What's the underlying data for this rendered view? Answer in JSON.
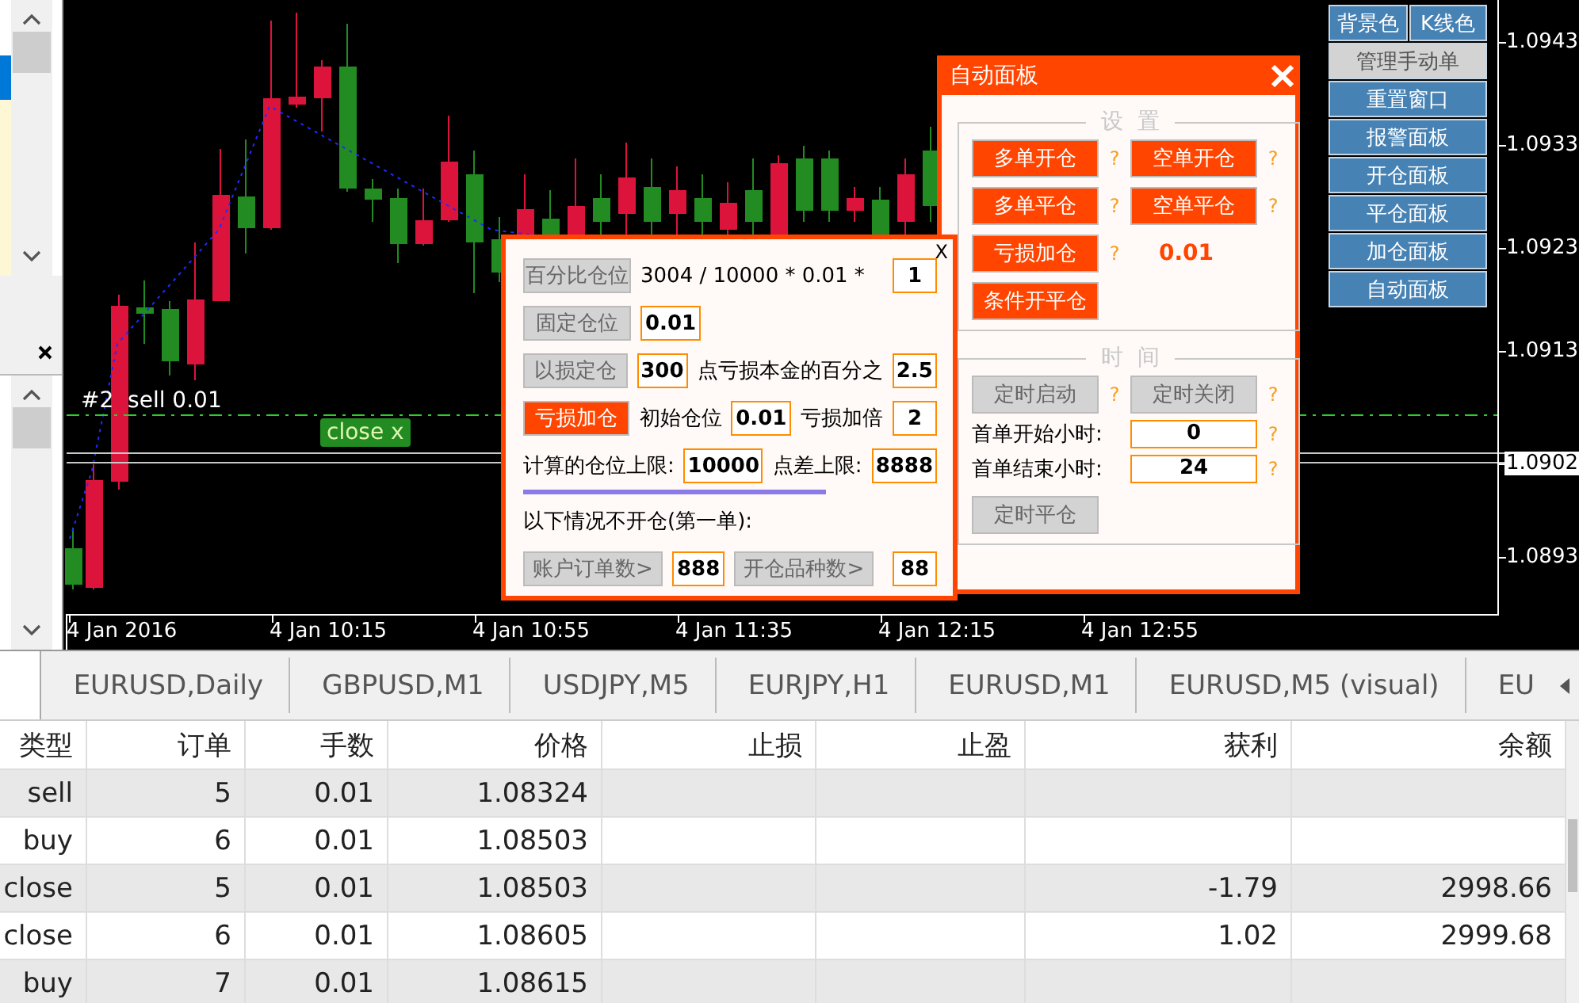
{
  "chart": {
    "order_label": "#2  sell 0.01",
    "close_badge": "close x",
    "price_labels": [
      {
        "label": "1.0943",
        "kind": "tick"
      },
      {
        "label": "1.0933",
        "kind": "tick"
      },
      {
        "label": "1.0923",
        "kind": "tick"
      },
      {
        "label": "1.0913",
        "kind": "tick"
      },
      {
        "label": "1.0902",
        "kind": "current"
      },
      {
        "label": "1.0893",
        "kind": "tick"
      }
    ],
    "time_labels": [
      "4 Jan 2016",
      "4 Jan 10:15",
      "4 Jan 10:55",
      "4 Jan 11:35",
      "4 Jan 12:15",
      "4 Jan 12:55"
    ]
  },
  "side_buttons": [
    {
      "buttons": [
        {
          "label": "背景色",
          "disabled": false
        },
        {
          "label": "K线色",
          "disabled": false
        }
      ]
    },
    {
      "buttons": [
        {
          "label": "管理手动单",
          "disabled": true
        }
      ]
    },
    {
      "buttons": [
        {
          "label": "重置窗口",
          "disabled": false
        }
      ]
    },
    {
      "buttons": [
        {
          "label": "报警面板",
          "disabled": false
        }
      ]
    },
    {
      "buttons": [
        {
          "label": "开仓面板",
          "disabled": false
        }
      ]
    },
    {
      "buttons": [
        {
          "label": "平仓面板",
          "disabled": false
        }
      ]
    },
    {
      "buttons": [
        {
          "label": "加仓面板",
          "disabled": false
        }
      ]
    },
    {
      "buttons": [
        {
          "label": "自动面板",
          "disabled": false
        }
      ]
    }
  ],
  "auto_panel": {
    "title": "自动面板",
    "settings_legend": "设  置",
    "settings": [
      {
        "kind": "button",
        "label": "多单开仓",
        "help": "?",
        "disabled": false
      },
      {
        "kind": "button",
        "label": "空单开仓",
        "help": "?",
        "disabled": false
      },
      {
        "kind": "button",
        "label": "多单平仓",
        "help": "?",
        "disabled": false
      },
      {
        "kind": "button",
        "label": "空单平仓",
        "help": "?",
        "disabled": false
      },
      {
        "kind": "button",
        "label": "亏损加仓",
        "help": "?",
        "disabled": false
      },
      {
        "kind": "value",
        "text": "0.01"
      },
      {
        "kind": "button",
        "label": "条件开平仓",
        "disabled": false
      }
    ],
    "time_legend": "时  间",
    "time_buttons": [
      {
        "label": "定时启动",
        "help": "?",
        "disabled": true
      },
      {
        "label": "定时关闭",
        "help": "?",
        "disabled": true
      }
    ],
    "hours": [
      {
        "label": "首单开始小时:",
        "value": "0",
        "help": "?"
      },
      {
        "label": "首单结束小时:",
        "value": "24",
        "help": "?"
      }
    ],
    "timed_close": {
      "label": "定时平仓",
      "disabled": true
    }
  },
  "calc_panel": {
    "close_label": "X",
    "mode_buttons": [
      {
        "label": "百分比仓位",
        "selected": false
      },
      {
        "label": "固定仓位",
        "selected": false
      },
      {
        "label": "以损定仓",
        "selected": false
      },
      {
        "label": "亏损加仓",
        "selected": true
      }
    ],
    "percent_formula": "3004 / 10000 * 0.01 *",
    "percent_value": "1",
    "fixed_lot": "0.01",
    "loss_points": "300",
    "loss_text": "点亏损本金的百分之",
    "loss_percent": "2.5",
    "martin_initial_label": "初始仓位",
    "martin_initial": "0.01",
    "martin_multiplier_label": "亏损加倍",
    "martin_multiplier": "2",
    "limit_label": "计算的仓位上限:",
    "limit_value": "10000",
    "spread_label": "点差上限:",
    "spread_value": "8888",
    "condition_label": "以下情况不开仓(第一单):",
    "conditions": [
      {
        "label": "账户订单数>",
        "value": "888",
        "selected": false
      },
      {
        "label": "开仓品种数>",
        "value": "88",
        "selected": false
      }
    ]
  },
  "tabs": [
    "EURUSD,Daily",
    "GBPUSD,M1",
    "USDJPY,M5",
    "EURJPY,H1",
    "EURUSD,M1",
    "EURUSD,M5 (visual)",
    "EU"
  ],
  "table": {
    "columns": [
      "类型",
      "订单",
      "手数",
      "价格",
      "止损",
      "止盈",
      "获利",
      "余额"
    ],
    "rows": [
      [
        "sell",
        "5",
        "0.01",
        "1.08324",
        "",
        "",
        "",
        ""
      ],
      [
        "buy",
        "6",
        "0.01",
        "1.08503",
        "",
        "",
        "",
        ""
      ],
      [
        "close",
        "5",
        "0.01",
        "1.08503",
        "",
        "",
        "-1.79",
        "2998.66"
      ],
      [
        "close",
        "6",
        "0.01",
        "1.08605",
        "",
        "",
        "1.02",
        "2999.68"
      ],
      [
        "buy",
        "7",
        "0.01",
        "1.08615",
        "",
        "",
        "",
        ""
      ]
    ]
  }
}
